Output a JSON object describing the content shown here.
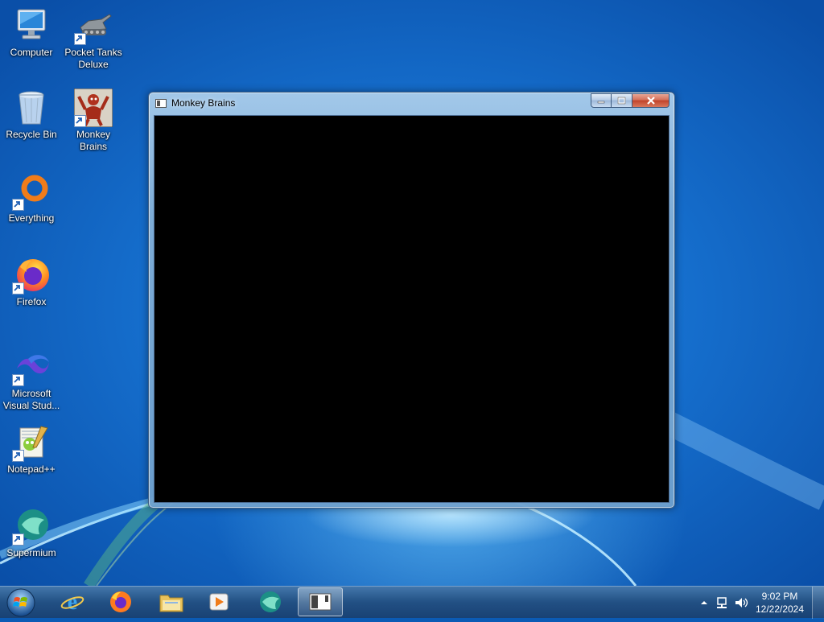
{
  "desktop": {
    "icons": [
      {
        "label": "Computer",
        "icon": "computer-icon"
      },
      {
        "label": "Pocket Tanks Deluxe",
        "icon": "pocket-tanks-icon"
      },
      {
        "label": "Recycle Bin",
        "icon": "recycle-bin-icon"
      },
      {
        "label": "Monkey Brains",
        "icon": "monkey-brains-icon"
      },
      {
        "label": "Everything",
        "icon": "everything-icon"
      },
      {
        "label": "Firefox",
        "icon": "firefox-icon"
      },
      {
        "label": "Microsoft Visual Stud...",
        "icon": "visual-studio-icon"
      },
      {
        "label": "Notepad++",
        "icon": "notepadpp-icon"
      },
      {
        "label": "Supermium",
        "icon": "supermium-icon"
      }
    ]
  },
  "window": {
    "title": "Monkey Brains",
    "client_background": "#000000"
  },
  "taskbar": {
    "pinned": [
      {
        "name": "Internet Explorer",
        "icon": "internet-explorer-icon"
      },
      {
        "name": "Firefox",
        "icon": "firefox-icon"
      },
      {
        "name": "File Explorer",
        "icon": "folder-icon"
      },
      {
        "name": "Media Player",
        "icon": "media-player-icon"
      },
      {
        "name": "Supermium",
        "icon": "supermium-icon"
      },
      {
        "name": "Monkey Brains",
        "icon": "app-window-icon",
        "active": true
      }
    ],
    "clock": {
      "time": "9:02 PM",
      "date": "12/22/2024"
    }
  }
}
